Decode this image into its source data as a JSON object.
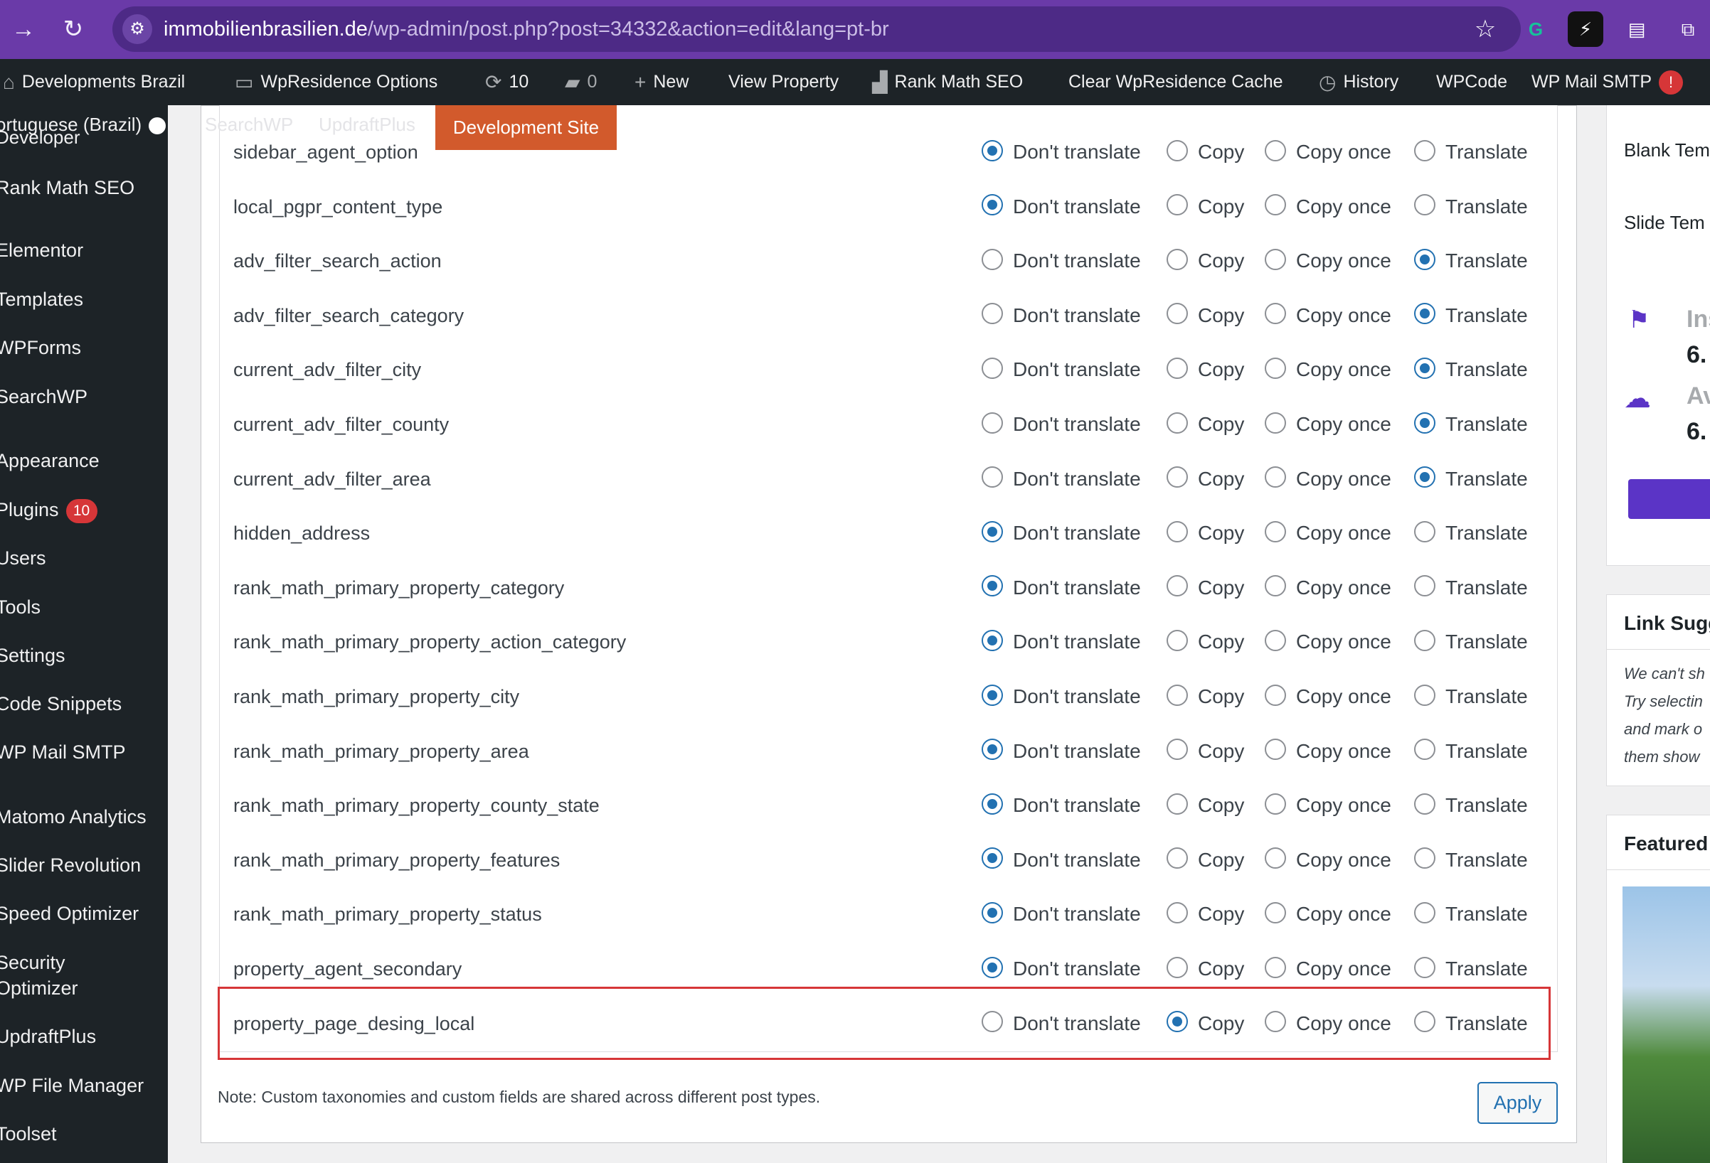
{
  "browser": {
    "url_domain": "immobilienbrasilien.de",
    "url_path": "/wp-admin/post.php?post=34332&action=edit&lang=pt-br"
  },
  "admin_bar": {
    "site_name": "Developments Brazil",
    "options": "WpResidence Options",
    "updates_count": "10",
    "comments_count": "0",
    "new_label": "New",
    "view_property": "View Property",
    "rank_math": "Rank Math SEO",
    "clear_cache": "Clear WpResidence Cache",
    "history": "History",
    "wpcode": "WPCode",
    "wp_mail": "WP Mail SMTP",
    "wp_mail_badge": "!"
  },
  "sidebar": {
    "top_sub_1": "ortuguese (Brazil)",
    "top_sub_2": "Developer",
    "items": [
      {
        "label": "Rank Math SEO"
      },
      {
        "label": "Elementor"
      },
      {
        "label": "Templates"
      },
      {
        "label": "WPForms"
      },
      {
        "label": "SearchWP"
      },
      {
        "label": "Appearance"
      },
      {
        "label": "Plugins",
        "badge": "10"
      },
      {
        "label": "Users"
      },
      {
        "label": "Tools"
      },
      {
        "label": "Settings"
      },
      {
        "label": "Code Snippets"
      },
      {
        "label": "WP Mail SMTP"
      },
      {
        "label": "Matomo Analytics"
      },
      {
        "label": "Slider Revolution"
      },
      {
        "label": "Speed Optimizer"
      },
      {
        "label": "Security"
      },
      {
        "label": "Optimizer"
      },
      {
        "label": "UpdraftPlus"
      },
      {
        "label": "WP File Manager"
      },
      {
        "label": "Toolset"
      }
    ]
  },
  "toolbar_ghost": {
    "searchwp": "SearchWP",
    "updraftplus": "UpdraftPlus"
  },
  "dev_site_label": "Development Site",
  "options": {
    "dont_translate": "Don't translate",
    "copy": "Copy",
    "copy_once": "Copy once",
    "translate": "Translate"
  },
  "fields": [
    {
      "name": "sidebar_agent_option",
      "selected": "dont_translate"
    },
    {
      "name": "local_pgpr_content_type",
      "selected": "dont_translate"
    },
    {
      "name": "adv_filter_search_action",
      "selected": "translate"
    },
    {
      "name": "adv_filter_search_category",
      "selected": "translate"
    },
    {
      "name": "current_adv_filter_city",
      "selected": "translate"
    },
    {
      "name": "current_adv_filter_county",
      "selected": "translate"
    },
    {
      "name": "current_adv_filter_area",
      "selected": "translate"
    },
    {
      "name": "hidden_address",
      "selected": "dont_translate"
    },
    {
      "name": "rank_math_primary_property_category",
      "selected": "dont_translate"
    },
    {
      "name": "rank_math_primary_property_action_category",
      "selected": "dont_translate"
    },
    {
      "name": "rank_math_primary_property_city",
      "selected": "dont_translate"
    },
    {
      "name": "rank_math_primary_property_area",
      "selected": "dont_translate"
    },
    {
      "name": "rank_math_primary_property_county_state",
      "selected": "dont_translate"
    },
    {
      "name": "rank_math_primary_property_features",
      "selected": "dont_translate"
    },
    {
      "name": "rank_math_primary_property_status",
      "selected": "dont_translate"
    },
    {
      "name": "property_agent_secondary",
      "selected": "dont_translate"
    },
    {
      "name": "property_page_desing_local",
      "selected": "copy"
    }
  ],
  "note": "Note: Custom taxonomies and custom fields are shared across different post types.",
  "apply_label": "Apply",
  "right_panel": {
    "blank_template": "Blank Tem",
    "slide_template": "Slide Tem",
    "installed_label": "Ins",
    "installed_version": "6.",
    "available_label": "Av",
    "available_version": "6.",
    "link_suggestions_title": "Link Sugg",
    "link_text_1": "We can't sh",
    "link_text_2": "Try selectin",
    "link_text_3": "and mark o",
    "link_text_4": "them show",
    "featured_title": "Featured"
  },
  "colors": {
    "browser_purple": "#6a3aa8",
    "admin_dark": "#1d2327",
    "wp_blue": "#2271b1",
    "badge_red": "#d63638",
    "dev_site_orange": "#d25a2c"
  }
}
